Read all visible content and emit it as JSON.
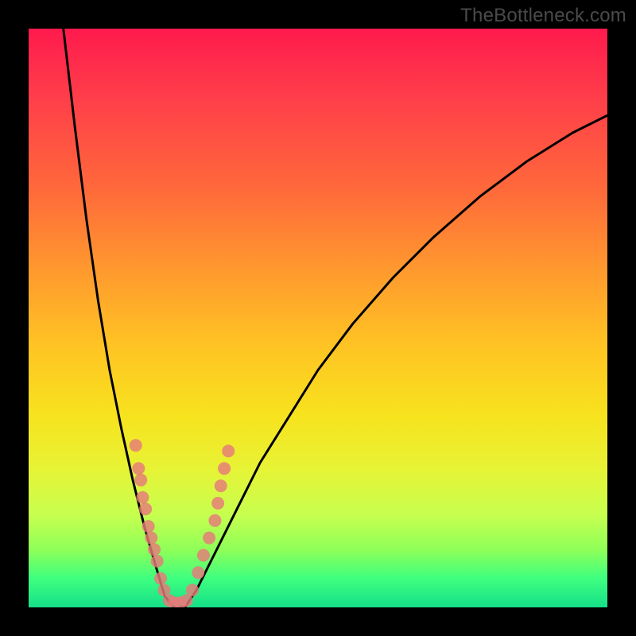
{
  "watermark": "TheBottleneck.com",
  "chart_data": {
    "type": "line",
    "title": "",
    "xlabel": "",
    "ylabel": "",
    "xlim": [
      0,
      100
    ],
    "ylim": [
      0,
      100
    ],
    "series": [
      {
        "name": "bottleneck-curve",
        "x": [
          6,
          8,
          10,
          12,
          14,
          16,
          18,
          20,
          22,
          23.5,
          25,
          27,
          29,
          32,
          36,
          40,
          45,
          50,
          56,
          63,
          70,
          78,
          86,
          94,
          100
        ],
        "y": [
          100,
          83,
          67,
          53,
          41,
          31,
          22,
          14,
          7,
          2,
          0,
          0,
          3,
          9,
          17,
          25,
          33,
          41,
          49,
          57,
          64,
          71,
          77,
          82,
          85
        ]
      }
    ],
    "markers": {
      "name": "highlight-points",
      "color": "#e77a7a",
      "points": [
        {
          "x": 18.5,
          "y": 28
        },
        {
          "x": 19.0,
          "y": 24
        },
        {
          "x": 19.4,
          "y": 22
        },
        {
          "x": 19.7,
          "y": 19
        },
        {
          "x": 20.2,
          "y": 17
        },
        {
          "x": 20.7,
          "y": 14
        },
        {
          "x": 21.2,
          "y": 12
        },
        {
          "x": 21.7,
          "y": 10
        },
        {
          "x": 22.2,
          "y": 8
        },
        {
          "x": 22.8,
          "y": 5
        },
        {
          "x": 23.4,
          "y": 3
        },
        {
          "x": 24.3,
          "y": 1.2
        },
        {
          "x": 25.2,
          "y": 0.8
        },
        {
          "x": 26.2,
          "y": 0.8
        },
        {
          "x": 27.3,
          "y": 1.2
        },
        {
          "x": 28.3,
          "y": 3
        },
        {
          "x": 29.3,
          "y": 6
        },
        {
          "x": 30.2,
          "y": 9
        },
        {
          "x": 31.2,
          "y": 12
        },
        {
          "x": 32.2,
          "y": 15
        },
        {
          "x": 32.7,
          "y": 18
        },
        {
          "x": 33.2,
          "y": 21
        },
        {
          "x": 33.8,
          "y": 24
        },
        {
          "x": 34.5,
          "y": 27
        }
      ]
    }
  }
}
